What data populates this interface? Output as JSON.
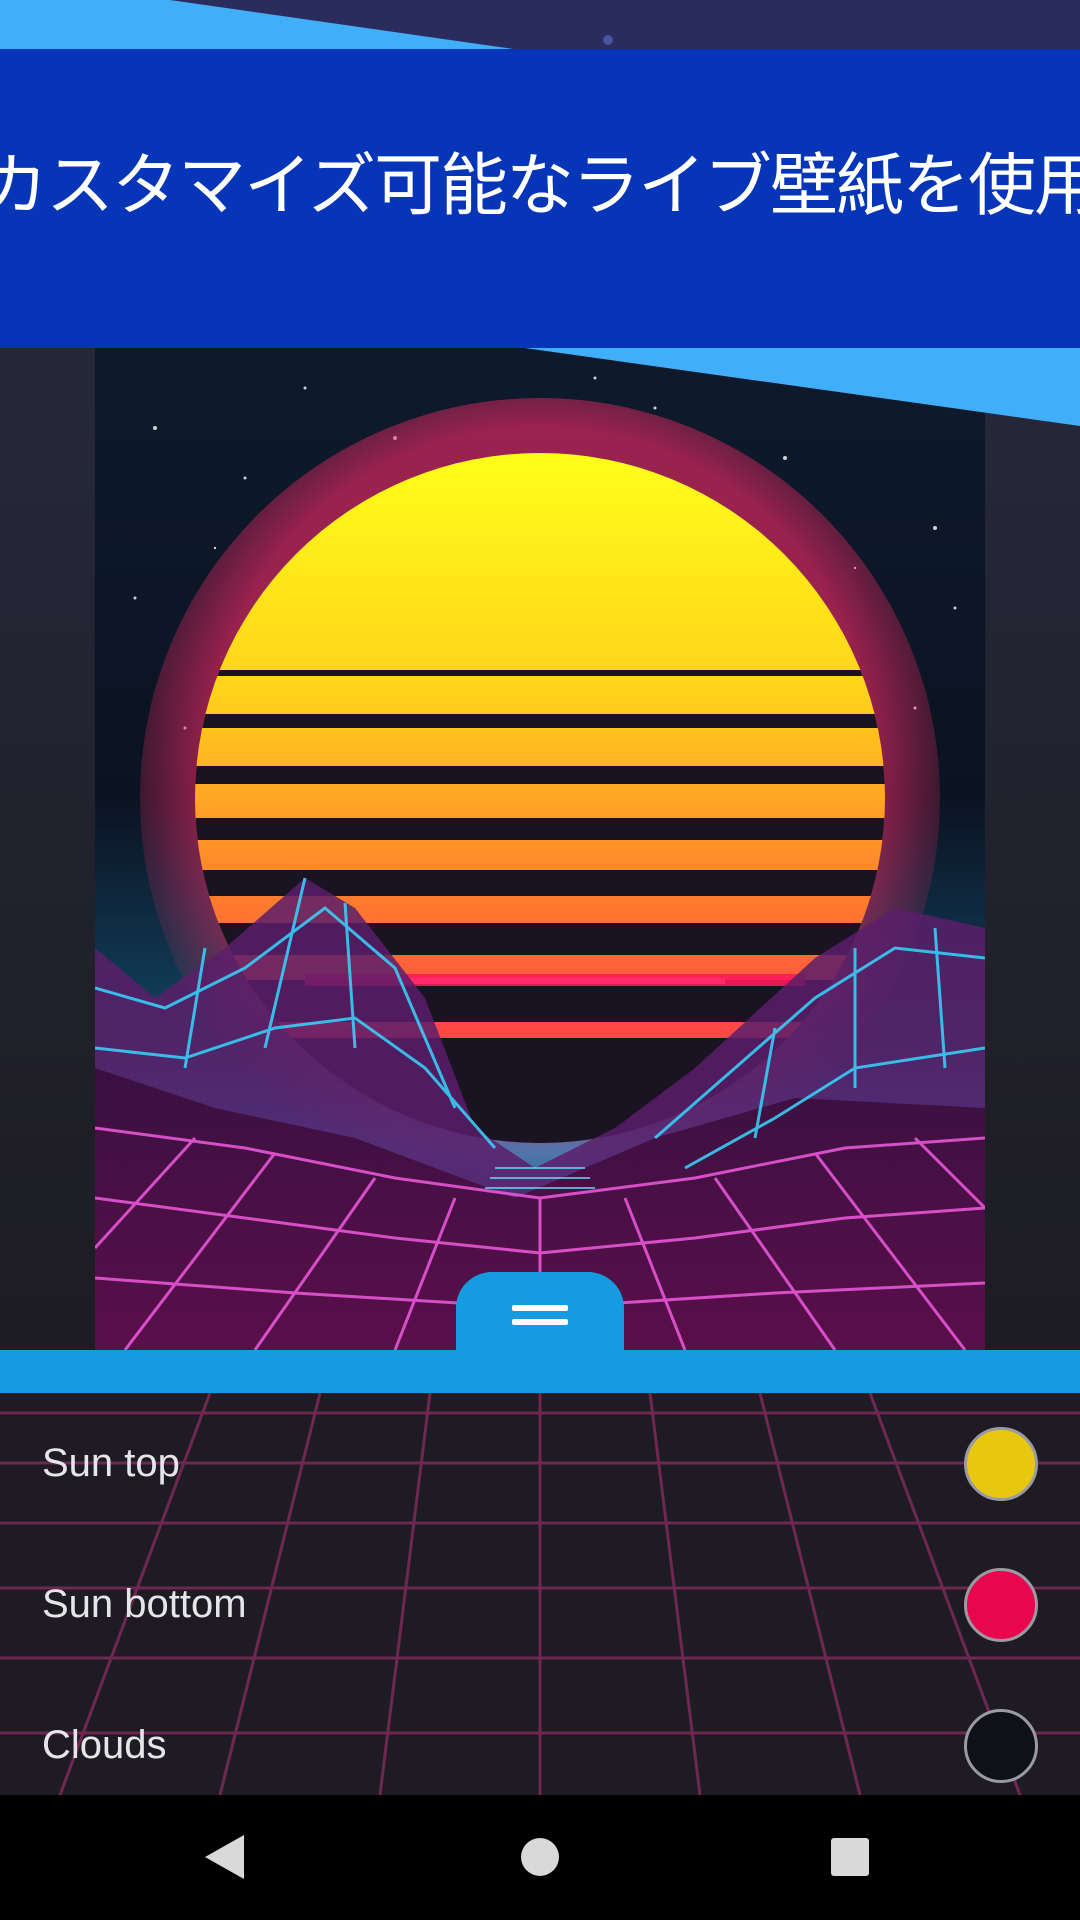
{
  "banner": {
    "title": "カスタマイズ可能なライブ壁紙を使用"
  },
  "colors": {
    "banner_bg": "#0635b8",
    "accent_blue": "#179be0",
    "ribbon_blue": "#41aef9",
    "sun_top": "#e8c70f",
    "sun_bottom": "#e8064f",
    "clouds": "#0e1118"
  },
  "settings": {
    "items": [
      {
        "label": "Sun top",
        "color": "#e8c70f"
      },
      {
        "label": "Sun bottom",
        "color": "#e8064f"
      },
      {
        "label": "Clouds",
        "color": "#0e1118"
      }
    ]
  },
  "navigation": {
    "back": "back-icon",
    "home": "home-icon",
    "recents": "recents-icon"
  }
}
